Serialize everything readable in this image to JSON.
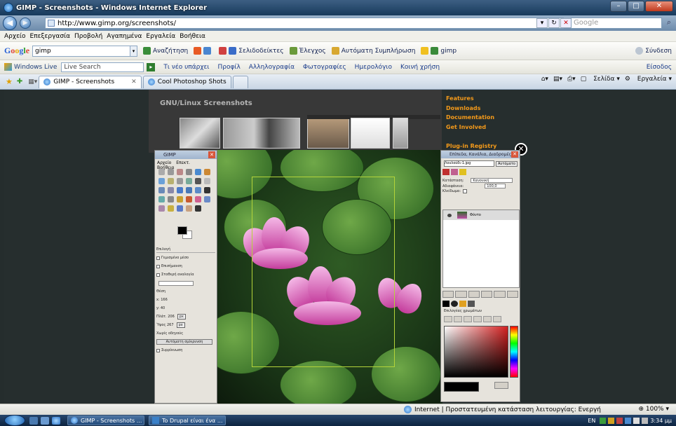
{
  "window": {
    "title": "GIMP - Screenshots - Windows Internet Explorer"
  },
  "nav": {
    "url": "http://www.gimp.org/screenshots/",
    "search_placeholder": "Google",
    "back": "◀",
    "forward": "▶"
  },
  "menu": [
    "Αρχείο",
    "Επεξεργασία",
    "Προβολή",
    "Αγαπημένα",
    "Εργαλεία",
    "Βοήθεια"
  ],
  "google_bar": {
    "logo": "Google",
    "query": "gimp",
    "buttons": [
      "Αναζήτηση",
      "Σελιδοδείκτες",
      "Έλεγχος",
      "Αυτόματη Συμπλήρωση",
      "gimp"
    ],
    "signin": "Σύνδεση"
  },
  "live_bar": {
    "brand": "Windows Live",
    "search_placeholder": "Live Search",
    "links": [
      "Τι νέο υπάρχει",
      "Προφίλ",
      "Αλληλογραφία",
      "Φωτογραφίες",
      "Ημερολόγιο",
      "Κοινή χρήση"
    ],
    "signin": "Είσοδος"
  },
  "tabs": [
    {
      "label": "GIMP - Screenshots",
      "active": true
    },
    {
      "label": "Cool Photoshop Shots",
      "active": false
    }
  ],
  "cmdbar": [
    "Σελίδα",
    "Εργαλεία"
  ],
  "page": {
    "heading": "GNU/Linux Screenshots",
    "sidebar": [
      "Features",
      "Downloads",
      "Documentation",
      "Get Involved"
    ],
    "plugin": "Plug-in Registry",
    "close": "✕"
  },
  "gimp_toolbox": {
    "title": "GIMP",
    "menu": [
      "Αρχείο",
      "Επεκτ.",
      "Βοήθεια"
    ],
    "options": {
      "title": "Επιλογή",
      "rows": [
        "Γεμισμένο μέσο",
        "Επισήμανση",
        "Σταθερή αναλογία",
        "Θέση"
      ],
      "pos_x": "x: 166",
      "pos_y": "y: 40",
      "size_w": "Πλάτ. 206",
      "size_h": "Ύψος 267",
      "unit": "px",
      "guides": "Χωρίς οδηγούς",
      "autoshrink": "Αυτόματη σμίκρυνση",
      "shrink": "Συρρίκνωση"
    }
  },
  "layers": {
    "title": "Επίπεδα, Κανάλια, Διαδρομές",
    "image": "Λουλούδι-1.jpg",
    "auto": "Αυτόματο",
    "mode_label": "Κατάσταση:",
    "mode": "Κανονική",
    "opacity_label": "Αδιαφάνεια:",
    "opacity": "100,0",
    "lock": "Κλείδωμα:",
    "layer_name": "Φόντο",
    "colors_label": "Επιλογέας χρωμάτων"
  },
  "status": {
    "zone": "Internet | Προστατευμένη κατάσταση λειτουργίας: Ενεργή",
    "zoom": "100%"
  },
  "taskbar": {
    "buttons": [
      "GIMP - Screenshots ...",
      "To Drupal είναι ένα ..."
    ],
    "lang": "EN",
    "time": "3:34 μμ"
  }
}
